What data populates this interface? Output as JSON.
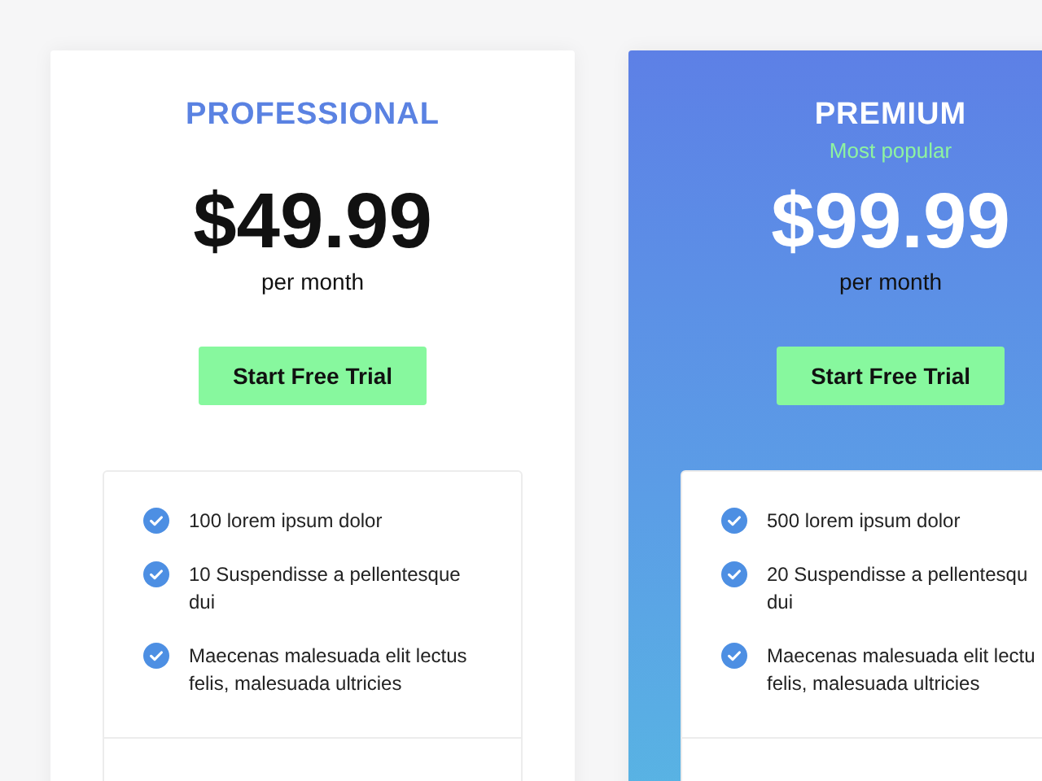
{
  "plans": [
    {
      "name": "PROFESSIONAL",
      "highlighted": false,
      "price": "$49.99",
      "period": "per month",
      "button": "Start Free Trial",
      "features": [
        "100 lorem ipsum dolor",
        "10 Suspendisse a pellentesque\ndui",
        "Maecenas malesuada elit lectus\nfelis, malesuada ultricies"
      ]
    },
    {
      "name": "PREMIUM",
      "highlighted": true,
      "badge": "Most popular",
      "price": "$99.99",
      "period": "per month",
      "button": "Start Free Trial",
      "features": [
        "500 lorem ipsum dolor",
        "20 Suspendisse a pellentesqu\ndui",
        "Maecenas malesuada elit lectu\nfelis, malesuada ultricies"
      ]
    }
  ]
}
